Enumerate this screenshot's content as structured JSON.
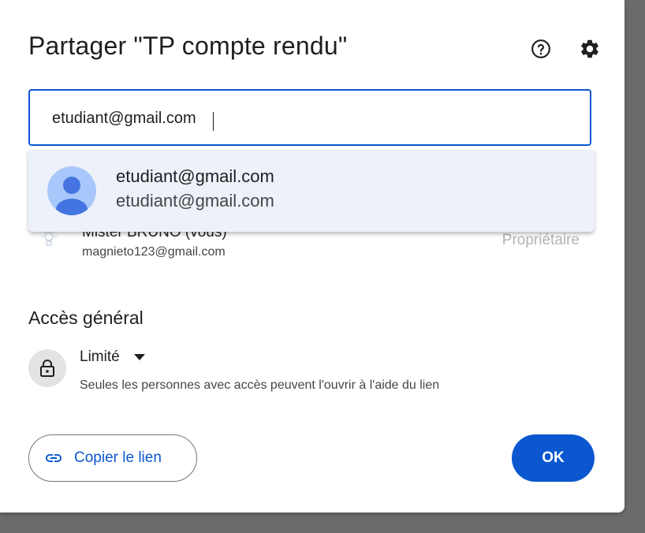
{
  "dialog": {
    "title": "Partager \"TP compte rendu\"",
    "help_icon": "help-circle-icon",
    "settings_icon": "gear-icon"
  },
  "search": {
    "value": "etudiant@gmail.com"
  },
  "suggestion": {
    "name": "etudiant@gmail.com",
    "email": "etudiant@gmail.com",
    "avatar_icon": "person-avatar-icon"
  },
  "owner": {
    "name": "Mister BRUNO (vous)",
    "email": "magnieto123@gmail.com",
    "role": "Propriétaire"
  },
  "general_access": {
    "title": "Accès général",
    "level": "Limité",
    "description": "Seules les personnes avec accès peuvent l'ouvrir à l'aide du lien"
  },
  "buttons": {
    "copy_link": "Copier le lien",
    "ok": "OK"
  },
  "colors": {
    "accent": "#0b57d0",
    "suggestion_bg": "#edf1fa",
    "backdrop": "#6b6b6b"
  }
}
